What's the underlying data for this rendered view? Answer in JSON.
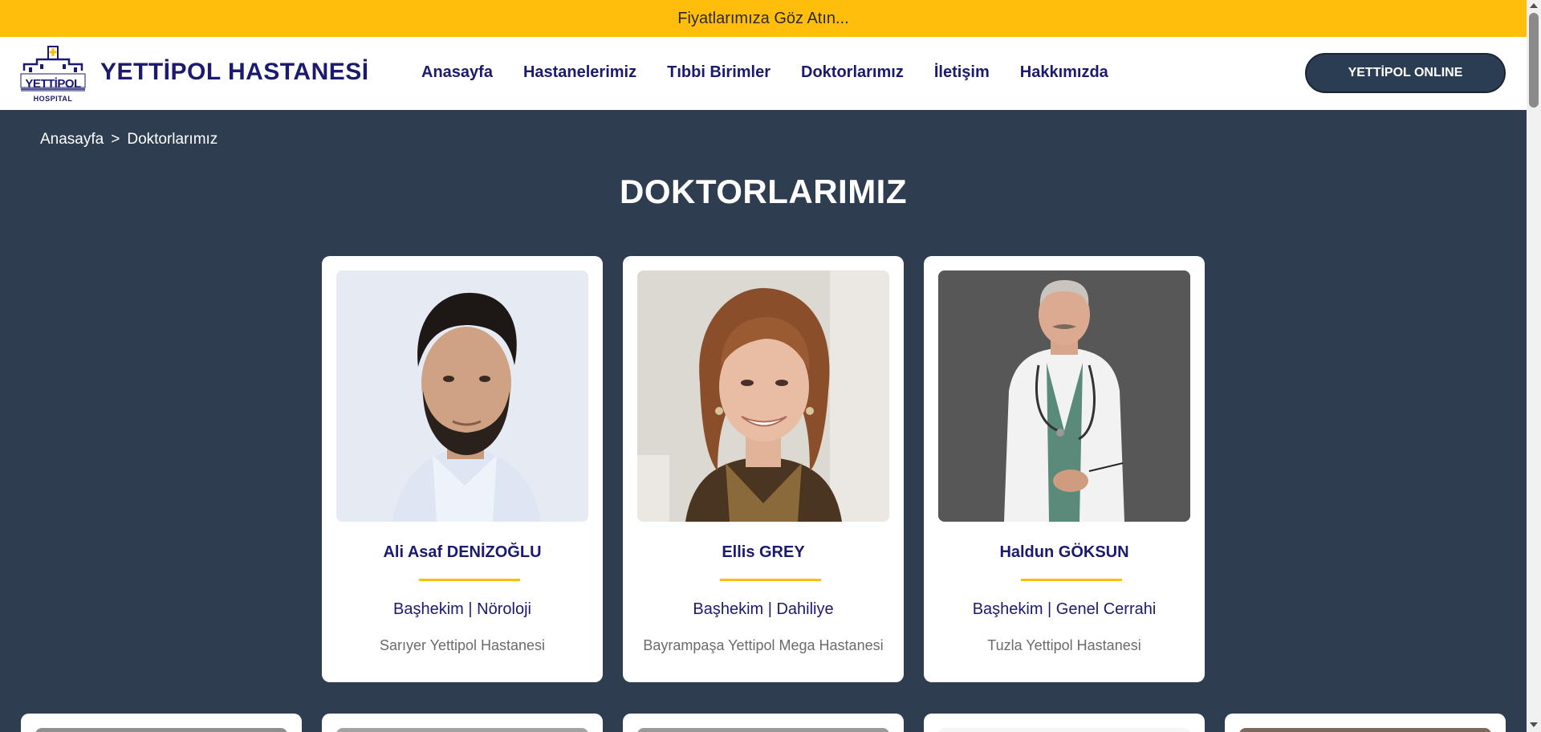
{
  "announcement": {
    "text": "Fiyatlarımıza Göz Atın..."
  },
  "header": {
    "logo": {
      "line1": "YETTİPOL",
      "line2": "HOSPITAL"
    },
    "brand": "YETTİPOL HASTANESİ",
    "nav": [
      "Anasayfa",
      "Hastanelerimiz",
      "Tıbbi Birimler",
      "Doktorlarımız",
      "İletişim",
      "Hakkımızda"
    ],
    "online_button": "YETTİPOL ONLINE"
  },
  "breadcrumb": {
    "home": "Anasayfa",
    "separator": ">",
    "current": "Doktorlarımız"
  },
  "page_title": "DOKTORLARIMIZ",
  "doctors": [
    {
      "name": "Ali Asaf DENİZOĞLU",
      "title": "Başhekim | Nöroloji",
      "hospital": "Sarıyer Yettipol Hastanesi"
    },
    {
      "name": "Ellis GREY",
      "title": "Başhekim | Dahiliye",
      "hospital": "Bayrampaşa Yettipol Mega Hastanesi"
    },
    {
      "name": "Haldun GÖKSUN",
      "title": "Başhekim | Genel Cerrahi",
      "hospital": "Tuzla Yettipol Hastanesi"
    }
  ],
  "colors": {
    "accent": "#ffbe0b",
    "navy": "#1b1a6e",
    "background": "#2e3e50"
  }
}
